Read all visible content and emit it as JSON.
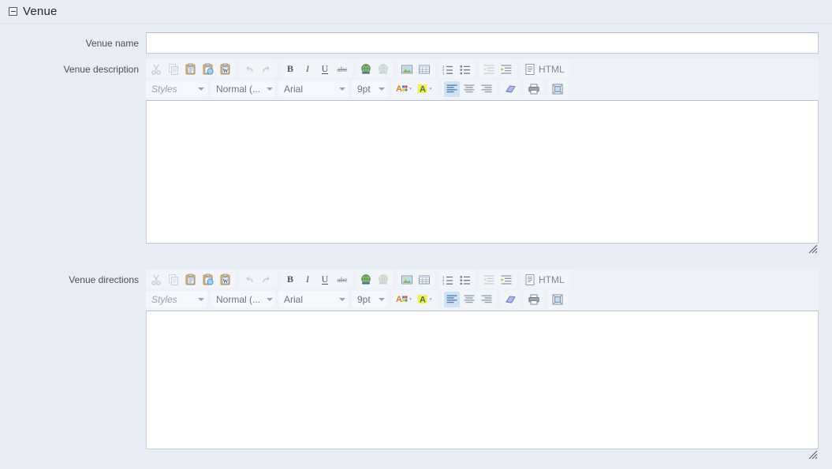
{
  "section": {
    "title": "Venue",
    "collapse_icon": "collapse-minus-icon"
  },
  "fields": {
    "venue_name": {
      "label": "Venue name",
      "value": "",
      "placeholder": ""
    },
    "venue_description": {
      "label": "Venue description",
      "value": ""
    },
    "venue_directions": {
      "label": "Venue directions",
      "value": ""
    }
  },
  "editor_toolbar": {
    "row1": [
      {
        "name": "cut-icon",
        "title": "Cut",
        "enabled": false
      },
      {
        "name": "copy-icon",
        "title": "Copy",
        "enabled": false
      },
      {
        "name": "paste-icon",
        "title": "Paste",
        "enabled": true
      },
      {
        "name": "paste-text-icon",
        "title": "Paste as plain text",
        "enabled": true
      },
      {
        "name": "paste-word-icon",
        "title": "Paste from Word",
        "enabled": true
      },
      {
        "name": "undo-icon",
        "title": "Undo",
        "enabled": false
      },
      {
        "name": "redo-icon",
        "title": "Redo",
        "enabled": false
      },
      {
        "name": "bold-icon",
        "title": "Bold",
        "enabled": true,
        "label": "B"
      },
      {
        "name": "italic-icon",
        "title": "Italic",
        "enabled": true,
        "label": "I"
      },
      {
        "name": "underline-icon",
        "title": "Underline",
        "enabled": true,
        "label": "U"
      },
      {
        "name": "strikethrough-icon",
        "title": "Strike Through",
        "enabled": true,
        "label": "abc"
      },
      {
        "name": "link-icon",
        "title": "Link",
        "enabled": true
      },
      {
        "name": "unlink-icon",
        "title": "Unlink",
        "enabled": false
      },
      {
        "name": "image-icon",
        "title": "Image",
        "enabled": true
      },
      {
        "name": "table-icon",
        "title": "Table",
        "enabled": true
      },
      {
        "name": "numbered-list-icon",
        "title": "Insert/Remove Numbered List",
        "enabled": true
      },
      {
        "name": "bulleted-list-icon",
        "title": "Insert/Remove Bulleted List",
        "enabled": true
      },
      {
        "name": "outdent-icon",
        "title": "Decrease Indent",
        "enabled": false
      },
      {
        "name": "indent-icon",
        "title": "Increase Indent",
        "enabled": true
      },
      {
        "name": "html-source-icon",
        "title": "HTML",
        "enabled": true
      }
    ],
    "html_button_label": "HTML",
    "row2": [
      {
        "name": "text-color-icon",
        "title": "Text Color",
        "enabled": true
      },
      {
        "name": "background-color-icon",
        "title": "Background Color",
        "enabled": true
      },
      {
        "name": "align-left-icon",
        "title": "Align Left",
        "enabled": true,
        "active": true
      },
      {
        "name": "align-center-icon",
        "title": "Center",
        "enabled": true,
        "active": false
      },
      {
        "name": "align-right-icon",
        "title": "Align Right",
        "enabled": true,
        "active": false
      },
      {
        "name": "remove-format-icon",
        "title": "Remove Format",
        "enabled": true
      },
      {
        "name": "print-icon",
        "title": "Print",
        "enabled": true
      },
      {
        "name": "maximize-icon",
        "title": "Maximize",
        "enabled": true
      }
    ],
    "combos": {
      "styles": "Styles",
      "format": "Normal (...",
      "font": "Arial",
      "size": "9pt"
    }
  },
  "colors": {
    "page_background": "#e8edf5",
    "toolbar_background": "#eef2f8",
    "field_background": "#ffffff",
    "field_border": "#c2c8ce",
    "label_text": "#4a5056",
    "title_text": "#23282d",
    "active_button": "#cfe3f7"
  }
}
